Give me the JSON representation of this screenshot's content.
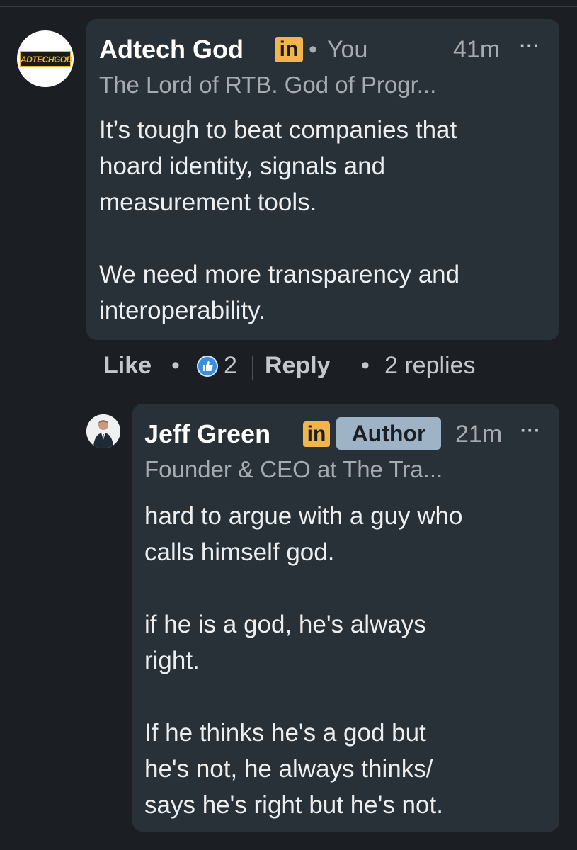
{
  "comment": {
    "author": "Adtech God",
    "linkedin_badge": "in",
    "relation": "You",
    "time": "41m",
    "more": "···",
    "headline": "The Lord of RTB. God of Progr...",
    "avatar_text": "ADTECHGOD",
    "body_lines": [
      "It’s tough to beat companies that",
      "hoard identity, signals and",
      "measurement tools.",
      "",
      "We need more transparency and",
      "interoperability."
    ],
    "actions": {
      "like": "Like",
      "reaction_count": "2",
      "reply": "Reply",
      "replies": "2 replies"
    }
  },
  "reply": {
    "author": "Jeff Green",
    "linkedin_badge": "in",
    "role_badge": "Author",
    "time": "21m",
    "more": "···",
    "headline": "Founder & CEO at The Tra...",
    "body_lines": [
      "hard to argue with a guy who",
      "calls himself god.",
      "",
      "if he is a god, he's always",
      "right.",
      "",
      "If he thinks he's a god but",
      "he's not, he always thinks/",
      "says he's right but he's not."
    ]
  },
  "colors": {
    "background": "#1b1f23",
    "bubble": "#293138",
    "linkedin_badge": "#f1b54a",
    "author_badge": "#9fb3c7",
    "reaction": "#3b8de0"
  },
  "icons": {
    "separator": "•",
    "reaction": "like-thumb-icon"
  }
}
